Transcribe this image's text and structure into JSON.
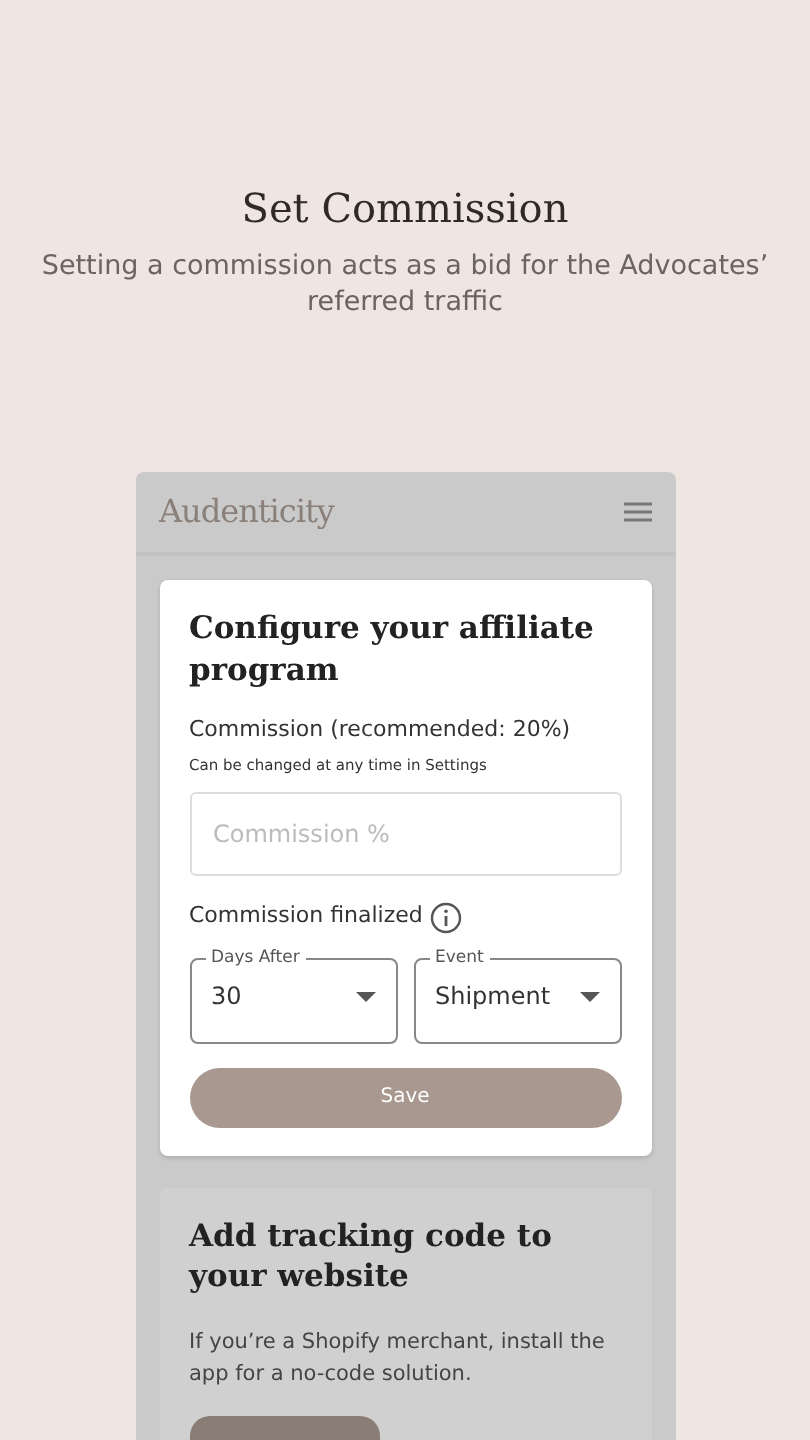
{
  "heading": "Set Commission",
  "subheading": "Setting a commission acts as a bid for the Advocates’ referred traffic",
  "app": {
    "logo": "Audenticity"
  },
  "commission_card": {
    "title": "Configure your affiliate program",
    "label": "Commission (recommended: 20%)",
    "hint": "Can be changed at any time in Settings",
    "field": {
      "placeholder": "Commission %"
    },
    "finalized_label": "Commission finalized",
    "selects": [
      {
        "label": "Days After",
        "value": "30"
      },
      {
        "label": "Event",
        "value": "Shipment"
      }
    ],
    "save_button": {
      "label": "Save",
      "disabled": true
    }
  },
  "tracking_card": {
    "title": "Add tracking code to your website",
    "text": "If you’re a Shopify merchant, install the app for a no-code solution."
  }
}
